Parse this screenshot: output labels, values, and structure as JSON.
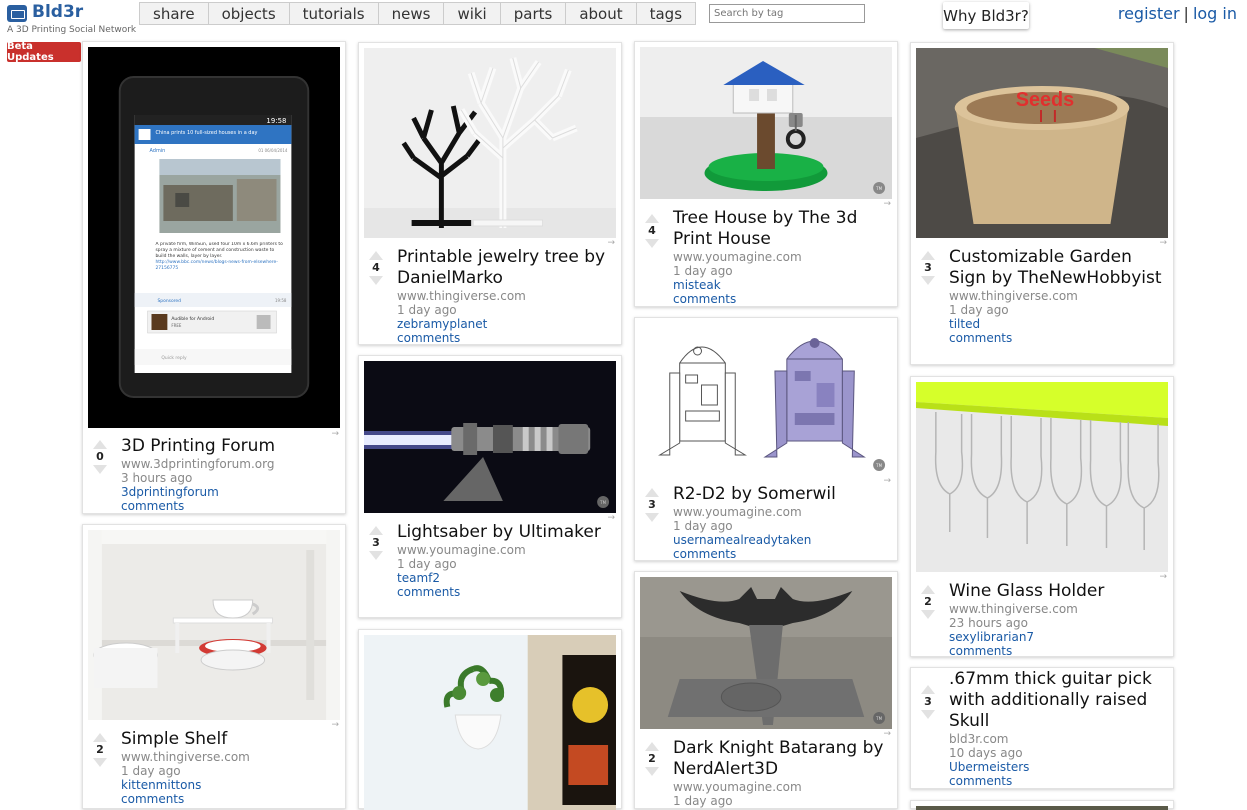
{
  "header": {
    "logo": "Bld3r",
    "tagline": "A 3D Printing Social Network",
    "beta_button": "Beta Updates",
    "nav": [
      {
        "label": "share"
      },
      {
        "label": "objects"
      },
      {
        "label": "tutorials"
      },
      {
        "label": "news"
      },
      {
        "label": "wiki"
      },
      {
        "label": "parts"
      },
      {
        "label": "about"
      },
      {
        "label": "tags"
      }
    ],
    "search_placeholder": "Search by tag",
    "why_button": "Why Bld3r?",
    "register": "register",
    "login": "log in",
    "separator": "|"
  },
  "share_arrow": "→",
  "cards": [
    {
      "title": "3D Printing Forum",
      "site": "www.3dprintingforum.org",
      "time": "3 hours ago",
      "user": "3dprintingforum",
      "comments": "comments",
      "votes": "0"
    },
    {
      "title": "Simple Shelf",
      "site": "www.thingiverse.com",
      "time": "1 day ago",
      "user": "kittenmittons",
      "comments": "comments",
      "votes": "2"
    },
    {
      "title": "Printable jewelry tree by DanielMarko",
      "site": "www.thingiverse.com",
      "time": "1 day ago",
      "user": "zebramyplanet",
      "comments": "comments",
      "votes": "4"
    },
    {
      "title": "Lightsaber by Ultimaker",
      "site": "www.youmagine.com",
      "time": "1 day ago",
      "user": "teamf2",
      "comments": "comments",
      "votes": "3"
    },
    {
      "title": "",
      "site": "",
      "time": "",
      "user": "",
      "comments": "",
      "votes": ""
    },
    {
      "title": "Tree House by The 3d Print House",
      "site": "www.youmagine.com",
      "time": "1 day ago",
      "user": "misteak",
      "comments": "comments",
      "votes": "4"
    },
    {
      "title": "R2-D2 by Somerwil",
      "site": "www.youmagine.com",
      "time": "1 day ago",
      "user": "usernamealreadytaken",
      "comments": "comments",
      "votes": "3"
    },
    {
      "title": "Dark Knight Batarang by NerdAlert3D",
      "site": "www.youmagine.com",
      "time": "1 day ago",
      "user": "",
      "comments": "",
      "votes": "2"
    },
    {
      "title": "Customizable Garden Sign by TheNewHobbyist",
      "site": "www.thingiverse.com",
      "time": "1 day ago",
      "user": "tilted",
      "comments": "comments",
      "votes": "3"
    },
    {
      "title": "Wine Glass Holder",
      "site": "www.thingiverse.com",
      "time": "23 hours ago",
      "user": "sexylibrarian7",
      "comments": "comments",
      "votes": "2"
    },
    {
      "title": ".67mm thick guitar pick with additionally raised Skull",
      "site": "bld3r.com",
      "time": "10 days ago",
      "user": "Ubermeisters",
      "comments": "comments",
      "votes": "3"
    }
  ],
  "images": {
    "forum_phone": {
      "status_time": "19:58",
      "headline": "China prints 10 full-sized houses in a day",
      "author": "Admin",
      "date": "01 06/04/2014",
      "body": "A private firm, WinSun, used four 10m x 6.6m printers to spray a mixture of cement and construction waste to build the walls, layer by layer.",
      "link": "http://www.bbc.com/news/blogs-news-from-elsewhere-27156775",
      "sponsored": "Sponsored",
      "sponsored_time": "19:58",
      "ad_title": "Audible for Android",
      "ad_sub": "FREE",
      "reply": "Quick reply"
    },
    "garden_sign": "Seeds",
    "tm_mark": "TM"
  }
}
